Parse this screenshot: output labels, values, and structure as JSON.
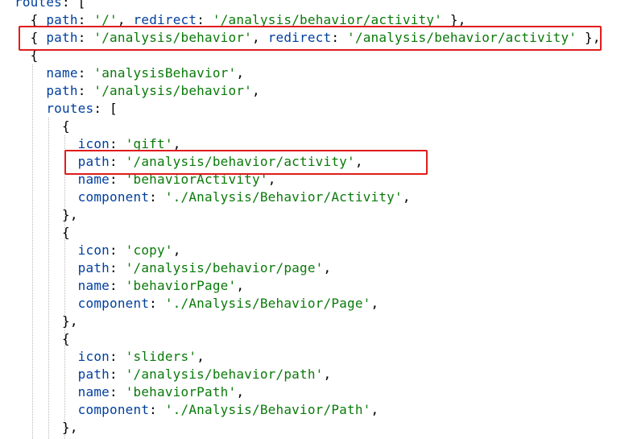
{
  "code_lines": [
    [
      {
        "t": "routes",
        "c": "k"
      },
      {
        "t": ": [",
        "c": "p"
      }
    ],
    [
      {
        "t": "  { ",
        "c": "p"
      },
      {
        "t": "path",
        "c": "k"
      },
      {
        "t": ": ",
        "c": "p"
      },
      {
        "t": "'/'",
        "c": "s"
      },
      {
        "t": ", ",
        "c": "p"
      },
      {
        "t": "redirect",
        "c": "k"
      },
      {
        "t": ": ",
        "c": "p"
      },
      {
        "t": "'/analysis/behavior/activity'",
        "c": "s"
      },
      {
        "t": " },",
        "c": "p"
      }
    ],
    [
      {
        "t": "  { ",
        "c": "p"
      },
      {
        "t": "path",
        "c": "k"
      },
      {
        "t": ": ",
        "c": "p"
      },
      {
        "t": "'/analysis/behavior'",
        "c": "s"
      },
      {
        "t": ", ",
        "c": "p"
      },
      {
        "t": "redirect",
        "c": "k"
      },
      {
        "t": ": ",
        "c": "p"
      },
      {
        "t": "'/analysis/behavior/activity'",
        "c": "s"
      },
      {
        "t": " },",
        "c": "p"
      }
    ],
    [
      {
        "t": "  {",
        "c": "p"
      }
    ],
    [
      {
        "t": "    ",
        "c": "p"
      },
      {
        "t": "name",
        "c": "k"
      },
      {
        "t": ": ",
        "c": "p"
      },
      {
        "t": "'analysisBehavior'",
        "c": "s"
      },
      {
        "t": ",",
        "c": "p"
      }
    ],
    [
      {
        "t": "    ",
        "c": "p"
      },
      {
        "t": "path",
        "c": "k"
      },
      {
        "t": ": ",
        "c": "p"
      },
      {
        "t": "'/analysis/behavior'",
        "c": "s"
      },
      {
        "t": ",",
        "c": "p"
      }
    ],
    [
      {
        "t": "    ",
        "c": "p"
      },
      {
        "t": "routes",
        "c": "k"
      },
      {
        "t": ": [",
        "c": "p"
      }
    ],
    [
      {
        "t": "      {",
        "c": "p"
      }
    ],
    [
      {
        "t": "        ",
        "c": "p"
      },
      {
        "t": "icon",
        "c": "k"
      },
      {
        "t": ": ",
        "c": "p"
      },
      {
        "t": "'gift'",
        "c": "s"
      },
      {
        "t": ",",
        "c": "p"
      }
    ],
    [
      {
        "t": "        ",
        "c": "p"
      },
      {
        "t": "path",
        "c": "k"
      },
      {
        "t": ": ",
        "c": "p"
      },
      {
        "t": "'/analysis/behavior/activity'",
        "c": "s"
      },
      {
        "t": ",",
        "c": "p"
      }
    ],
    [
      {
        "t": "        ",
        "c": "p"
      },
      {
        "t": "name",
        "c": "k"
      },
      {
        "t": ": ",
        "c": "p"
      },
      {
        "t": "'behaviorActivity'",
        "c": "s"
      },
      {
        "t": ",",
        "c": "p"
      }
    ],
    [
      {
        "t": "        ",
        "c": "p"
      },
      {
        "t": "component",
        "c": "k"
      },
      {
        "t": ": ",
        "c": "p"
      },
      {
        "t": "'./Analysis/Behavior/Activity'",
        "c": "s"
      },
      {
        "t": ",",
        "c": "p"
      }
    ],
    [
      {
        "t": "      },",
        "c": "p"
      }
    ],
    [
      {
        "t": "      {",
        "c": "p"
      }
    ],
    [
      {
        "t": "        ",
        "c": "p"
      },
      {
        "t": "icon",
        "c": "k"
      },
      {
        "t": ": ",
        "c": "p"
      },
      {
        "t": "'copy'",
        "c": "s"
      },
      {
        "t": ",",
        "c": "p"
      }
    ],
    [
      {
        "t": "        ",
        "c": "p"
      },
      {
        "t": "path",
        "c": "k"
      },
      {
        "t": ": ",
        "c": "p"
      },
      {
        "t": "'/analysis/behavior/page'",
        "c": "s"
      },
      {
        "t": ",",
        "c": "p"
      }
    ],
    [
      {
        "t": "        ",
        "c": "p"
      },
      {
        "t": "name",
        "c": "k"
      },
      {
        "t": ": ",
        "c": "p"
      },
      {
        "t": "'behaviorPage'",
        "c": "s"
      },
      {
        "t": ",",
        "c": "p"
      }
    ],
    [
      {
        "t": "        ",
        "c": "p"
      },
      {
        "t": "component",
        "c": "k"
      },
      {
        "t": ": ",
        "c": "p"
      },
      {
        "t": "'./Analysis/Behavior/Page'",
        "c": "s"
      },
      {
        "t": ",",
        "c": "p"
      }
    ],
    [
      {
        "t": "      },",
        "c": "p"
      }
    ],
    [
      {
        "t": "      {",
        "c": "p"
      }
    ],
    [
      {
        "t": "        ",
        "c": "p"
      },
      {
        "t": "icon",
        "c": "k"
      },
      {
        "t": ": ",
        "c": "p"
      },
      {
        "t": "'sliders'",
        "c": "s"
      },
      {
        "t": ",",
        "c": "p"
      }
    ],
    [
      {
        "t": "        ",
        "c": "p"
      },
      {
        "t": "path",
        "c": "k"
      },
      {
        "t": ": ",
        "c": "p"
      },
      {
        "t": "'/analysis/behavior/path'",
        "c": "s"
      },
      {
        "t": ",",
        "c": "p"
      }
    ],
    [
      {
        "t": "        ",
        "c": "p"
      },
      {
        "t": "name",
        "c": "k"
      },
      {
        "t": ": ",
        "c": "p"
      },
      {
        "t": "'behaviorPath'",
        "c": "s"
      },
      {
        "t": ",",
        "c": "p"
      }
    ],
    [
      {
        "t": "        ",
        "c": "p"
      },
      {
        "t": "component",
        "c": "k"
      },
      {
        "t": ": ",
        "c": "p"
      },
      {
        "t": "'./Analysis/Behavior/Path'",
        "c": "s"
      },
      {
        "t": ",",
        "c": "p"
      }
    ],
    [
      {
        "t": "      },",
        "c": "p"
      }
    ]
  ],
  "colors": {
    "keyword": "#003f9e",
    "string": "#0a7a0a",
    "punctuation": "#000000",
    "highlight_border": "#e11c1c"
  }
}
